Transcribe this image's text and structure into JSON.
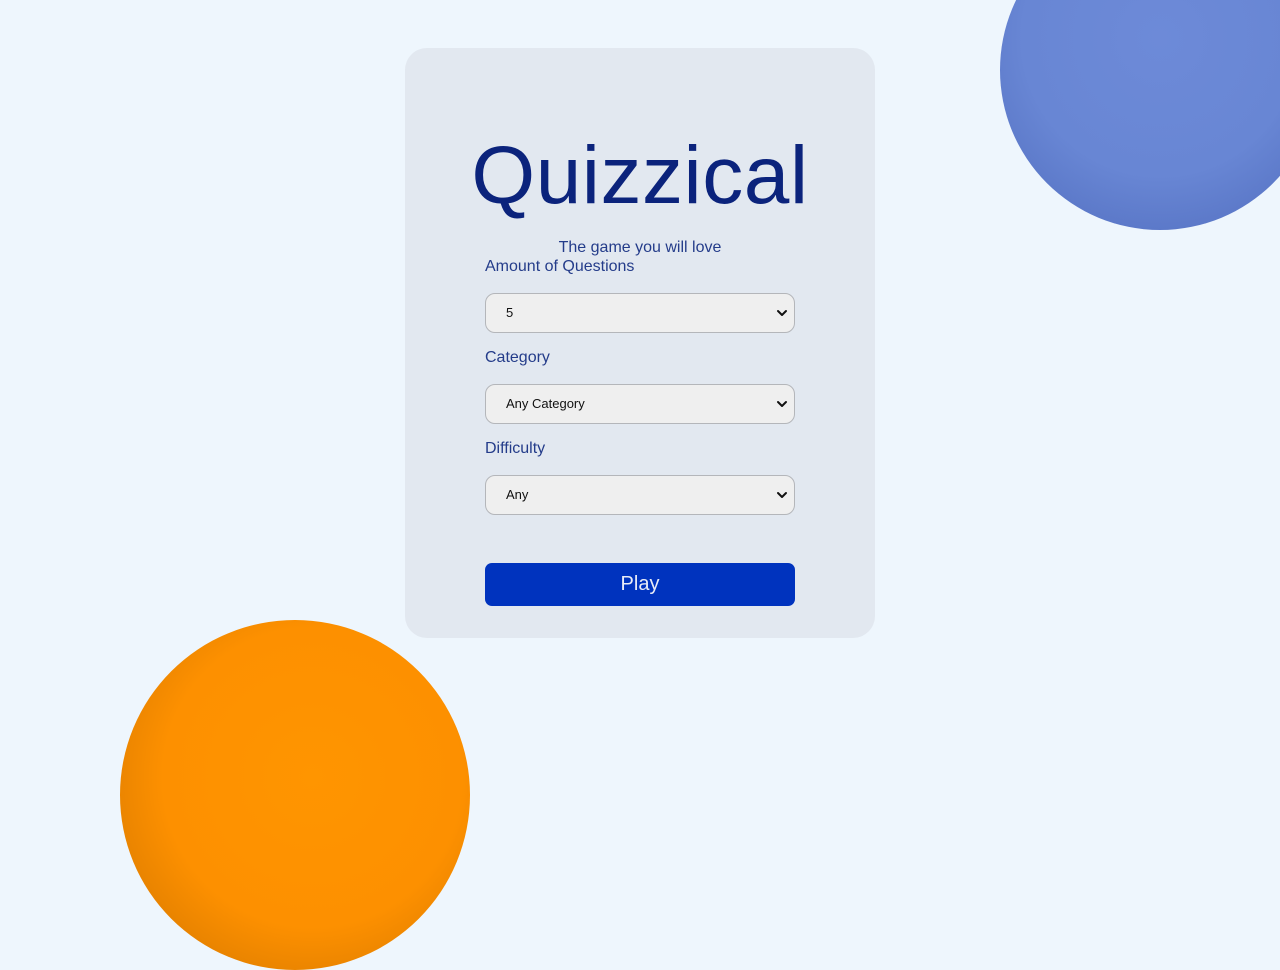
{
  "app": {
    "title": "Quizzical",
    "subtitle": "The game you will love"
  },
  "form": {
    "amount": {
      "label": "Amount of Questions",
      "selected": "5"
    },
    "category": {
      "label": "Category",
      "selected": "Any Category"
    },
    "difficulty": {
      "label": "Difficulty",
      "selected": "Any"
    },
    "play_label": "Play"
  },
  "icons": {
    "select_arrow": "chevron-down-icon"
  },
  "colors": {
    "background": "#eef6fd",
    "card": "#e2e8f0",
    "title": "#0b237c",
    "text": "#243c8a",
    "primary_button": "#0033be",
    "blob_blue": "#6886d4",
    "blob_orange": "#fd9000"
  }
}
